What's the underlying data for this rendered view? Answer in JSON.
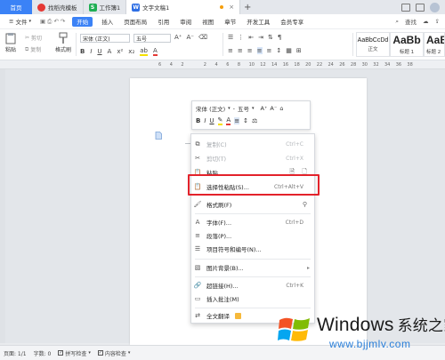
{
  "tabbar": {
    "home": "首页",
    "tabs": [
      {
        "label": "找稻壳模板",
        "icon_text": "",
        "icon_color": "#e53935",
        "active": false
      },
      {
        "label": "工作簿1",
        "icon_text": "S",
        "icon_color": "#1fae53",
        "active": false
      },
      {
        "label": "文字文稿1",
        "icon_text": "W",
        "icon_color": "#2f6fe4",
        "active": true
      }
    ],
    "plus": "+"
  },
  "menubar": {
    "file": "文件",
    "start": "开始",
    "items": [
      "插入",
      "页面布局",
      "引用",
      "审阅",
      "视图",
      "章节",
      "开发工具",
      "会员专享"
    ],
    "search": "查找"
  },
  "ribbon": {
    "paste": "粘贴",
    "cut": "剪切",
    "copy": "复制",
    "format_painter": "格式刷",
    "font_name": "宋体 (正文)",
    "font_size": "五号",
    "styles": [
      {
        "sample": "AaBbCcDd",
        "label": "正文"
      },
      {
        "sample": "AaBb",
        "label": "标题 1"
      },
      {
        "sample": "AaBb",
        "label": "标题 2"
      }
    ]
  },
  "ruler": {
    "ticks": [
      "6",
      "4",
      "2",
      "",
      "2",
      "4",
      "6",
      "8",
      "10",
      "12",
      "14",
      "16",
      "18",
      "20",
      "22",
      "24",
      "26",
      "28",
      "30",
      "32",
      "34",
      "36",
      "38"
    ]
  },
  "minibar": {
    "font_name": "宋体 (正文)",
    "font_size": "五号"
  },
  "context_menu": {
    "items": [
      {
        "label": "复制(C)",
        "shortcut": "Ctrl+C",
        "disabled": true,
        "icon": "copy-icon"
      },
      {
        "label": "剪切(T)",
        "shortcut": "Ctrl+X",
        "disabled": true,
        "icon": "scissors-icon"
      },
      {
        "label": "粘贴",
        "shortcut": "",
        "disabled": false,
        "icon": "paste-icon"
      },
      {
        "label": "选择性粘贴(S)...",
        "shortcut": "Ctrl+Alt+V",
        "disabled": false,
        "icon": "paste-special-icon"
      },
      {
        "label": "格式刷(F)",
        "shortcut": "",
        "disabled": false,
        "icon": "brush-icon"
      },
      {
        "label": "字体(F)...",
        "shortcut": "Ctrl+D",
        "disabled": false,
        "icon": "font-icon"
      },
      {
        "label": "段落(P)...",
        "shortcut": "",
        "disabled": false,
        "icon": "paragraph-icon"
      },
      {
        "label": "项目符号和编号(N)...",
        "shortcut": "",
        "disabled": false,
        "icon": "bullets-icon"
      },
      {
        "label": "图片背景(B)...",
        "shortcut": "",
        "disabled": false,
        "icon": "image-bg-icon"
      },
      {
        "label": "超链接(H)...",
        "shortcut": "Ctrl+K",
        "disabled": false,
        "icon": "link-icon"
      },
      {
        "label": "插入批注(M)",
        "shortcut": "",
        "disabled": false,
        "icon": "comment-icon"
      },
      {
        "label": "全文翻译",
        "shortcut": "",
        "disabled": false,
        "icon": "translate-icon"
      }
    ]
  },
  "statusbar": {
    "page": "页面: 1/1",
    "words": "字数: 0",
    "spellcheck": "拼写检查",
    "content_check": "内容检查"
  },
  "watermark": {
    "title": "Windows",
    "title_cn": "系统之家",
    "url": "www.bjjmlv.com"
  },
  "colors": {
    "accent": "#3b82f6",
    "highlight_box": "#e3222b"
  }
}
